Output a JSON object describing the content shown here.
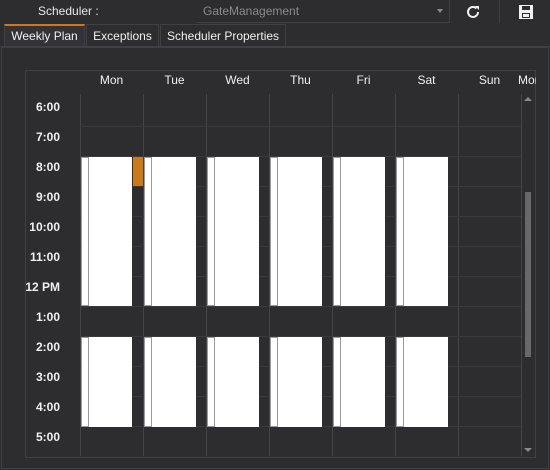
{
  "toolbar": {
    "scheduler_label": "Scheduler :",
    "scheduler_value": "GateManagement",
    "refresh_icon": "refresh-icon",
    "save_icon": "save-disk-icon"
  },
  "tabs": [
    {
      "label": "Weekly Plan",
      "active": true
    },
    {
      "label": "Exceptions",
      "active": false
    },
    {
      "label": "Scheduler Properties",
      "active": false
    }
  ],
  "days": [
    "Mon",
    "Tue",
    "Wed",
    "Thu",
    "Fri",
    "Sat",
    "Sun",
    "Mon"
  ],
  "times": [
    "6:00",
    "7:00",
    "8:00",
    "9:00",
    "10:00",
    "11:00",
    "12 PM",
    "1:00",
    "2:00",
    "3:00",
    "4:00",
    "5:00"
  ],
  "colors": {
    "accent": "#ca7a1a",
    "slot": "#ffffff",
    "background": "#2d2d30"
  }
}
